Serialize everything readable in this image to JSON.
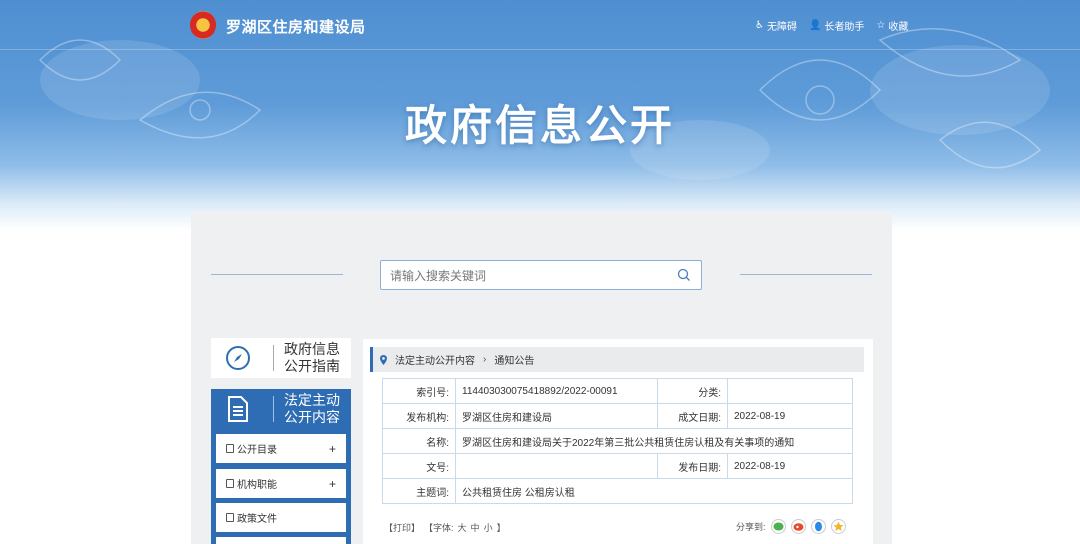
{
  "header": {
    "site_title": "罗湖区住房和建设局",
    "links": [
      {
        "label": "无障碍",
        "icon": "accessibility-icon"
      },
      {
        "label": "长者助手",
        "icon": "elder-icon"
      },
      {
        "label": "收藏",
        "icon": "star-icon"
      }
    ],
    "hero_title": "政府信息公开"
  },
  "search": {
    "placeholder": "请输入搜索关键词",
    "value": ""
  },
  "sidebar": {
    "guide": {
      "line1": "政府信息",
      "line2": "公开指南",
      "icon": "compass-icon"
    },
    "content": {
      "line1": "法定主动",
      "line2": "公开内容",
      "icon": "document-icon"
    },
    "items": [
      {
        "label": "公开目录",
        "expand": "+"
      },
      {
        "label": "机构职能",
        "expand": "+"
      },
      {
        "label": "政策文件",
        "expand": ""
      }
    ]
  },
  "breadcrumb": {
    "parent": "法定主动公开内容",
    "current": "通知公告"
  },
  "info": {
    "index_label": "索引号:",
    "index_value": "114403030075418892/2022-00091",
    "category_label": "分类:",
    "category_value": "",
    "org_label": "发布机构:",
    "org_value": "罗湖区住房和建设局",
    "created_label": "成文日期:",
    "created_value": "2022-08-19",
    "name_label": "名称:",
    "name_value": "罗湖区住房和建设局关于2022年第三批公共租赁住房认租及有关事项的通知",
    "docno_label": "文号:",
    "docno_value": "",
    "published_label": "发布日期:",
    "published_value": "2022-08-19",
    "subject_label": "主题词:",
    "subject_value": "公共租赁住房 公租房认租"
  },
  "tools": {
    "print": "【打印】",
    "font_prefix": "【字体:",
    "large": "大",
    "medium": "中",
    "small": "小",
    "font_suffix": "】"
  },
  "share": {
    "label": "分享到:",
    "targets": [
      {
        "name": "wechat-icon",
        "color": "#4caf50"
      },
      {
        "name": "weibo-icon",
        "color": "#e6492e"
      },
      {
        "name": "qq-icon",
        "color": "#2e8ae6"
      },
      {
        "name": "favorite-icon",
        "color": "#f0b429"
      }
    ]
  },
  "colors": {
    "primary": "#2e6db4",
    "banner": "#5e9bd8",
    "panel": "#eff0f1"
  }
}
